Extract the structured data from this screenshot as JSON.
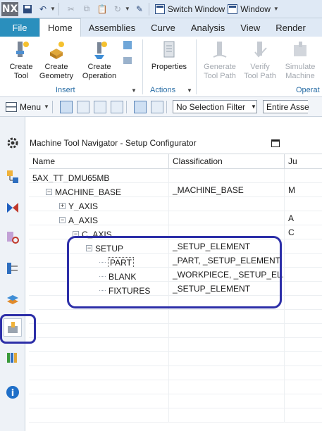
{
  "app": {
    "logo": "NX"
  },
  "quick_access": {
    "switch_window": "Switch Window",
    "window": "Window"
  },
  "tabs": [
    "File",
    "Home",
    "Assemblies",
    "Curve",
    "Analysis",
    "View",
    "Render"
  ],
  "ribbon": {
    "buttons": [
      {
        "label": "Create\nTool",
        "icon": "create-tool-icon",
        "enabled": true
      },
      {
        "label": "Create\nGeometry",
        "icon": "create-geometry-icon",
        "enabled": true
      },
      {
        "label": "Create\nOperation",
        "icon": "create-operation-icon",
        "enabled": true
      },
      {
        "label": "Properties",
        "icon": "properties-icon",
        "enabled": true
      },
      {
        "label": "Generate\nTool Path",
        "icon": "generate-tool-path-icon",
        "enabled": false
      },
      {
        "label": "Verify\nTool Path",
        "icon": "verify-tool-path-icon",
        "enabled": false
      },
      {
        "label": "Simulate\nMachine",
        "icon": "simulate-machine-icon",
        "enabled": false
      }
    ],
    "groups": [
      "Insert",
      "Actions",
      "Operat"
    ]
  },
  "toolbar2": {
    "menu": "Menu",
    "selection_filter": "No Selection Filter",
    "scope": "Entire Asse"
  },
  "navigator": {
    "title": "Machine Tool Navigator - Setup Configurator",
    "columns": [
      "Name",
      "Classification",
      "Ju"
    ],
    "rows": [
      {
        "name": "5AX_TT_DMU65MB",
        "classification": "",
        "ju": "",
        "indent": 0,
        "expander": "none"
      },
      {
        "name": "MACHINE_BASE",
        "classification": "_MACHINE_BASE",
        "ju": "M",
        "indent": 1,
        "expander": "minus"
      },
      {
        "name": "Y_AXIS",
        "classification": "",
        "ju": "",
        "indent": 2,
        "expander": "plus"
      },
      {
        "name": "A_AXIS",
        "classification": "",
        "ju": "A",
        "indent": 2,
        "expander": "minus"
      },
      {
        "name": "C_AXIS",
        "classification": "",
        "ju": "C",
        "indent": 3,
        "expander": "minus"
      },
      {
        "name": "SETUP",
        "classification": "_SETUP_ELEMENT",
        "ju": "",
        "indent": 4,
        "expander": "minus"
      },
      {
        "name": "PART",
        "classification": "_PART, _SETUP_ELEMENT",
        "ju": "",
        "indent": 5,
        "expander": "leaf",
        "boxed": true
      },
      {
        "name": "BLANK",
        "classification": "_WORKPIECE, _SETUP_EL...",
        "ju": "",
        "indent": 5,
        "expander": "leaf"
      },
      {
        "name": "FIXTURES",
        "classification": "_SETUP_ELEMENT",
        "ju": "",
        "indent": 5,
        "expander": "leaf"
      }
    ]
  },
  "colors": {
    "accent": "#2a8fbd",
    "annotation": "#2d2fa8"
  }
}
